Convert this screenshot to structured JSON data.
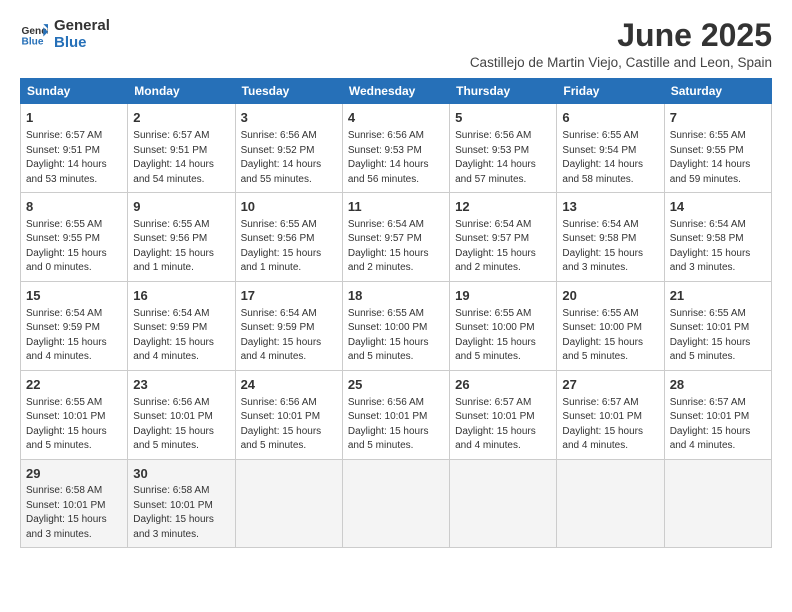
{
  "header": {
    "logo_line1": "General",
    "logo_line2": "Blue",
    "month_title": "June 2025",
    "subtitle": "Castillejo de Martin Viejo, Castille and Leon, Spain"
  },
  "weekdays": [
    "Sunday",
    "Monday",
    "Tuesday",
    "Wednesday",
    "Thursday",
    "Friday",
    "Saturday"
  ],
  "weeks": [
    [
      {
        "day": "1",
        "info": "Sunrise: 6:57 AM\nSunset: 9:51 PM\nDaylight: 14 hours\nand 53 minutes."
      },
      {
        "day": "2",
        "info": "Sunrise: 6:57 AM\nSunset: 9:51 PM\nDaylight: 14 hours\nand 54 minutes."
      },
      {
        "day": "3",
        "info": "Sunrise: 6:56 AM\nSunset: 9:52 PM\nDaylight: 14 hours\nand 55 minutes."
      },
      {
        "day": "4",
        "info": "Sunrise: 6:56 AM\nSunset: 9:53 PM\nDaylight: 14 hours\nand 56 minutes."
      },
      {
        "day": "5",
        "info": "Sunrise: 6:56 AM\nSunset: 9:53 PM\nDaylight: 14 hours\nand 57 minutes."
      },
      {
        "day": "6",
        "info": "Sunrise: 6:55 AM\nSunset: 9:54 PM\nDaylight: 14 hours\nand 58 minutes."
      },
      {
        "day": "7",
        "info": "Sunrise: 6:55 AM\nSunset: 9:55 PM\nDaylight: 14 hours\nand 59 minutes."
      }
    ],
    [
      {
        "day": "8",
        "info": "Sunrise: 6:55 AM\nSunset: 9:55 PM\nDaylight: 15 hours\nand 0 minutes."
      },
      {
        "day": "9",
        "info": "Sunrise: 6:55 AM\nSunset: 9:56 PM\nDaylight: 15 hours\nand 1 minute."
      },
      {
        "day": "10",
        "info": "Sunrise: 6:55 AM\nSunset: 9:56 PM\nDaylight: 15 hours\nand 1 minute."
      },
      {
        "day": "11",
        "info": "Sunrise: 6:54 AM\nSunset: 9:57 PM\nDaylight: 15 hours\nand 2 minutes."
      },
      {
        "day": "12",
        "info": "Sunrise: 6:54 AM\nSunset: 9:57 PM\nDaylight: 15 hours\nand 2 minutes."
      },
      {
        "day": "13",
        "info": "Sunrise: 6:54 AM\nSunset: 9:58 PM\nDaylight: 15 hours\nand 3 minutes."
      },
      {
        "day": "14",
        "info": "Sunrise: 6:54 AM\nSunset: 9:58 PM\nDaylight: 15 hours\nand 3 minutes."
      }
    ],
    [
      {
        "day": "15",
        "info": "Sunrise: 6:54 AM\nSunset: 9:59 PM\nDaylight: 15 hours\nand 4 minutes."
      },
      {
        "day": "16",
        "info": "Sunrise: 6:54 AM\nSunset: 9:59 PM\nDaylight: 15 hours\nand 4 minutes."
      },
      {
        "day": "17",
        "info": "Sunrise: 6:54 AM\nSunset: 9:59 PM\nDaylight: 15 hours\nand 4 minutes."
      },
      {
        "day": "18",
        "info": "Sunrise: 6:55 AM\nSunset: 10:00 PM\nDaylight: 15 hours\nand 5 minutes."
      },
      {
        "day": "19",
        "info": "Sunrise: 6:55 AM\nSunset: 10:00 PM\nDaylight: 15 hours\nand 5 minutes."
      },
      {
        "day": "20",
        "info": "Sunrise: 6:55 AM\nSunset: 10:00 PM\nDaylight: 15 hours\nand 5 minutes."
      },
      {
        "day": "21",
        "info": "Sunrise: 6:55 AM\nSunset: 10:01 PM\nDaylight: 15 hours\nand 5 minutes."
      }
    ],
    [
      {
        "day": "22",
        "info": "Sunrise: 6:55 AM\nSunset: 10:01 PM\nDaylight: 15 hours\nand 5 minutes."
      },
      {
        "day": "23",
        "info": "Sunrise: 6:56 AM\nSunset: 10:01 PM\nDaylight: 15 hours\nand 5 minutes."
      },
      {
        "day": "24",
        "info": "Sunrise: 6:56 AM\nSunset: 10:01 PM\nDaylight: 15 hours\nand 5 minutes."
      },
      {
        "day": "25",
        "info": "Sunrise: 6:56 AM\nSunset: 10:01 PM\nDaylight: 15 hours\nand 5 minutes."
      },
      {
        "day": "26",
        "info": "Sunrise: 6:57 AM\nSunset: 10:01 PM\nDaylight: 15 hours\nand 4 minutes."
      },
      {
        "day": "27",
        "info": "Sunrise: 6:57 AM\nSunset: 10:01 PM\nDaylight: 15 hours\nand 4 minutes."
      },
      {
        "day": "28",
        "info": "Sunrise: 6:57 AM\nSunset: 10:01 PM\nDaylight: 15 hours\nand 4 minutes."
      }
    ],
    [
      {
        "day": "29",
        "info": "Sunrise: 6:58 AM\nSunset: 10:01 PM\nDaylight: 15 hours\nand 3 minutes."
      },
      {
        "day": "30",
        "info": "Sunrise: 6:58 AM\nSunset: 10:01 PM\nDaylight: 15 hours\nand 3 minutes."
      },
      {
        "day": "",
        "info": ""
      },
      {
        "day": "",
        "info": ""
      },
      {
        "day": "",
        "info": ""
      },
      {
        "day": "",
        "info": ""
      },
      {
        "day": "",
        "info": ""
      }
    ]
  ]
}
